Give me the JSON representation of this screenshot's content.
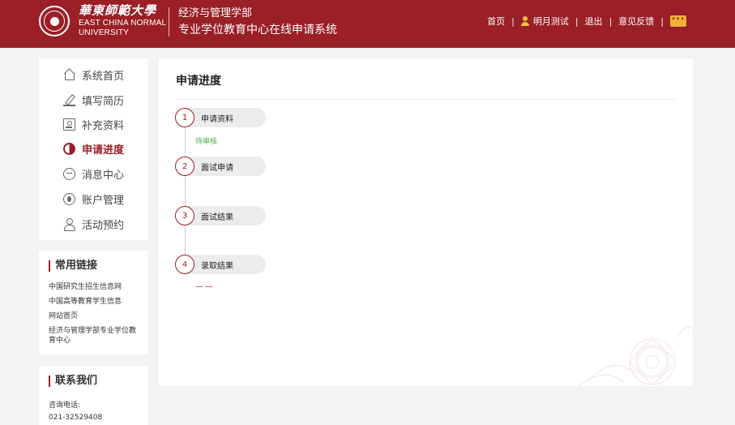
{
  "header": {
    "logo_cn": "華東師範大學",
    "logo_en_line1": "EAST CHINA NORMAL",
    "logo_en_line2": "UNIVERSITY",
    "dept_name": "经济与管理学部",
    "system_name": "专业学位教育中心在线申请系统",
    "nav": {
      "home": "首页",
      "user": "明月测试",
      "logout": "退出",
      "feedback": "意见反馈",
      "separator": "|"
    },
    "colors": {
      "brand": "#9a1f26",
      "icon_accent": "#f2c23a"
    }
  },
  "sidebar": {
    "items": [
      {
        "label": "系统首页",
        "icon": "home-icon"
      },
      {
        "label": "填写简历",
        "icon": "pen-icon"
      },
      {
        "label": "补充资料",
        "icon": "document-icon"
      },
      {
        "label": "申请进度",
        "icon": "progress-pie-icon",
        "active": true
      },
      {
        "label": "消息中心",
        "icon": "message-icon"
      },
      {
        "label": "账户管理",
        "icon": "account-icon"
      },
      {
        "label": "活动预约",
        "icon": "user-icon"
      }
    ]
  },
  "links": {
    "title": "常用链接",
    "items": [
      "中国研究生招生信息网",
      "中国高等教育学生信息",
      "网站首页",
      "经济与管理学部专业学位教育中心"
    ]
  },
  "contact": {
    "title": "联系我们",
    "phone_label": "咨询电话:",
    "phone": "021-32529408"
  },
  "main": {
    "title": "申请进度",
    "steps": [
      {
        "num": "1",
        "label": "申请资料",
        "status": "待审核"
      },
      {
        "num": "2",
        "label": "面试申请",
        "status": ""
      },
      {
        "num": "3",
        "label": "面试结果",
        "status": ""
      },
      {
        "num": "4",
        "label": "录取结果",
        "status": "——"
      }
    ],
    "colors": {
      "pending_status": "#4caf50"
    }
  }
}
